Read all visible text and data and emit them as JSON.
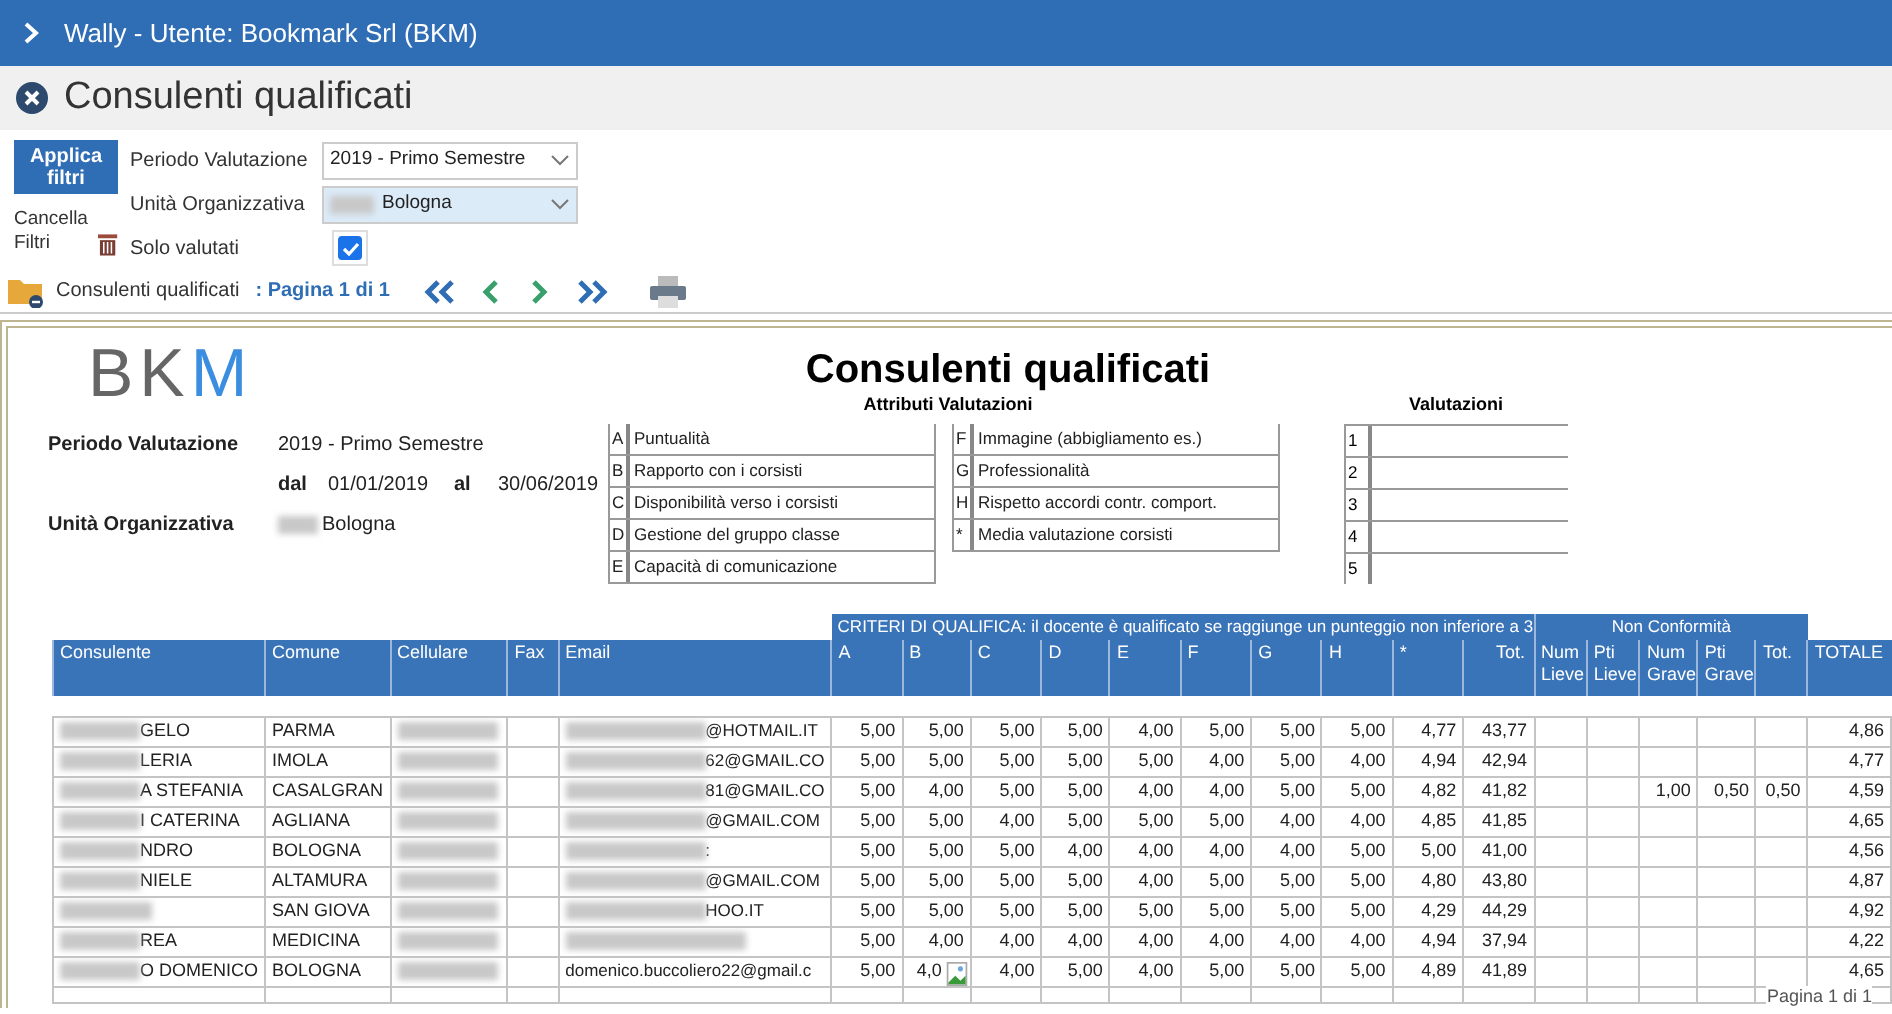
{
  "title_bar": {
    "text": "Wally - Utente: Bookmark Srl (BKM)"
  },
  "page": {
    "title": "Consulenti qualificati"
  },
  "filters": {
    "apply_button": "Applica filtri",
    "clear_label": "Cancella Filtri",
    "fields": [
      {
        "kind": "select",
        "label": "Periodo Valutazione",
        "value": "2019 - Primo Semestre",
        "focused": false
      },
      {
        "kind": "select",
        "label": "Unità Organizzativa",
        "value": "Bologna",
        "focused": true
      },
      {
        "kind": "checkbox",
        "label": "Solo valutati",
        "checked": true
      }
    ]
  },
  "toolbar": {
    "report_name": "Consulenti qualificati",
    "page_info": ": Pagina 1 di 1"
  },
  "report": {
    "logo": "BKM",
    "title": "Consulenti qualificati",
    "info": [
      {
        "label": "Periodo Valutazione",
        "value": "2019 - Primo Semestre"
      },
      {
        "label": "dal",
        "value": "01/01/2019"
      },
      {
        "label": "al",
        "value": "30/06/2019"
      },
      {
        "label": "Unità Organizzativa",
        "value": "Bologna"
      }
    ],
    "attributes_heading": "Attributi Valutazioni",
    "attributes": [
      {
        "code": "A",
        "label": "Puntualità"
      },
      {
        "code": "B",
        "label": "Rapporto con i corsisti"
      },
      {
        "code": "C",
        "label": "Disponibilità verso i corsisti"
      },
      {
        "code": "D",
        "label": "Gestione del gruppo classe"
      },
      {
        "code": "E",
        "label": "Capacità di comunicazione"
      },
      {
        "code": "F",
        "label": "Immagine (abbigliamento es.)"
      },
      {
        "code": "G",
        "label": "Professionalità"
      },
      {
        "code": "H",
        "label": "Rispetto accordi contr. comport."
      },
      {
        "code": "*",
        "label": "Media valutazione corsisti"
      }
    ],
    "ratings_heading": "Valutazioni",
    "ratings": [
      "1",
      "2",
      "3",
      "4",
      "5"
    ],
    "table": {
      "group_headers": [
        "CRITERI DI QUALIFICA: il docente è qualificato se raggiunge un punteggio non inferiore a 3",
        "Non Conformità"
      ],
      "columns": [
        "Consulente",
        "Comune",
        "Cellulare",
        "Fax",
        "Email",
        "A",
        "B",
        "C",
        "D",
        "E",
        "F",
        "G",
        "H",
        "*",
        "Tot.",
        "Num Lieve",
        "Pti Lieve",
        "Num Grave",
        "Pti Grave",
        "Tot.",
        "TOTALE"
      ],
      "rows": [
        {
          "consulente": "GELO",
          "comune": "PARMA",
          "email": "@HOTMAIL.IT",
          "scores": [
            "5,00",
            "5,00",
            "5,00",
            "5,00",
            "4,00",
            "5,00",
            "5,00",
            "5,00",
            "4,77",
            "43,77"
          ],
          "totale": "4,86",
          "broken_image": false
        },
        {
          "consulente": "LERIA",
          "comune": "IMOLA",
          "email": "62@GMAIL.CO",
          "scores": [
            "5,00",
            "5,00",
            "5,00",
            "5,00",
            "5,00",
            "4,00",
            "5,00",
            "4,00",
            "4,94",
            "42,94"
          ],
          "totale": "4,77",
          "broken_image": false
        },
        {
          "consulente": "A STEFANIA",
          "comune": "CASALGRAN",
          "email": "81@GMAIL.CO",
          "scores": [
            "5,00",
            "4,00",
            "5,00",
            "5,00",
            "4,00",
            "4,00",
            "5,00",
            "5,00",
            "4,82",
            "41,82"
          ],
          "non_conformita": {
            "num_grave": "1,00",
            "pti_grave": "0,50",
            "tot": "0,50"
          },
          "totale": "4,59",
          "broken_image": false
        },
        {
          "consulente": "I CATERINA",
          "comune": "AGLIANA",
          "email": "@GMAIL.COM",
          "scores": [
            "5,00",
            "5,00",
            "4,00",
            "5,00",
            "5,00",
            "5,00",
            "4,00",
            "4,00",
            "4,85",
            "41,85"
          ],
          "totale": "4,65",
          "broken_image": false
        },
        {
          "consulente": "NDRO",
          "comune": "BOLOGNA",
          "email": ":",
          "scores": [
            "5,00",
            "5,00",
            "5,00",
            "4,00",
            "4,00",
            "4,00",
            "4,00",
            "5,00",
            "5,00",
            "41,00"
          ],
          "totale": "4,56",
          "broken_image": false
        },
        {
          "consulente": "NIELE",
          "comune": "ALTAMURA",
          "email": "@GMAIL.COM",
          "scores": [
            "5,00",
            "5,00",
            "5,00",
            "5,00",
            "4,00",
            "5,00",
            "5,00",
            "5,00",
            "4,80",
            "43,80"
          ],
          "totale": "4,87",
          "broken_image": false
        },
        {
          "comune": "SAN GIOVA",
          "email": "HOO.IT",
          "scores": [
            "5,00",
            "5,00",
            "5,00",
            "5,00",
            "5,00",
            "5,00",
            "5,00",
            "5,00",
            "4,29",
            "44,29"
          ],
          "totale": "4,92",
          "broken_image": false
        },
        {
          "consulente": "REA",
          "comune": "MEDICINA",
          "scores": [
            "5,00",
            "4,00",
            "4,00",
            "4,00",
            "4,00",
            "4,00",
            "4,00",
            "4,00",
            "4,94",
            "37,94"
          ],
          "totale": "4,22",
          "broken_image": false
        },
        {
          "consulente": "O DOMENICO",
          "comune": "BOLOGNA",
          "email": "domenico.buccoliero22@gmail.c",
          "scores": [
            "5,00",
            "4,0",
            "4,00",
            "5,00",
            "4,00",
            "5,00",
            "5,00",
            "5,00",
            "4,89",
            "41,89"
          ],
          "totale": "4,65",
          "broken_image": true
        }
      ]
    },
    "footer": "Pagina 1 di 1"
  }
}
